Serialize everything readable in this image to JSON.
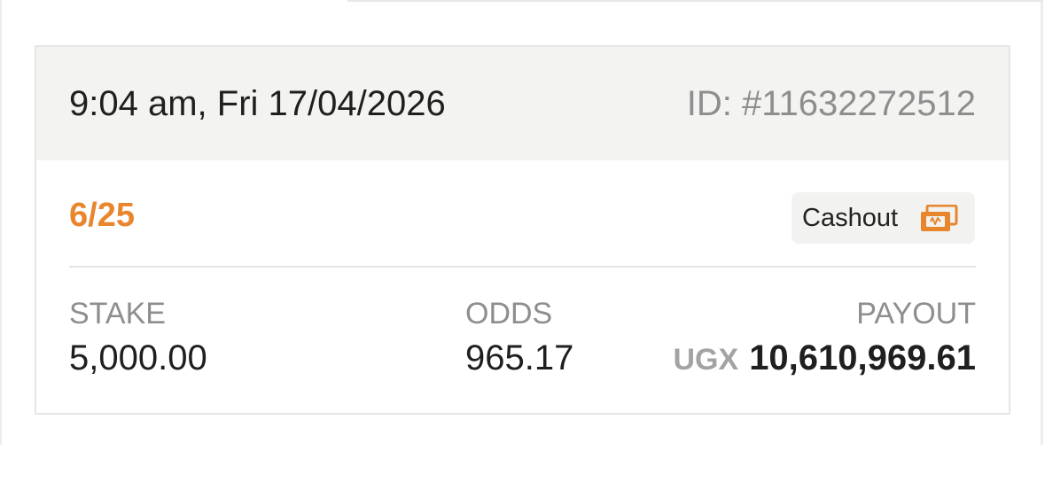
{
  "header": {
    "date_time": "9:04 am, Fri 17/04/2026",
    "bet_id": "ID: #11632272512"
  },
  "summary": {
    "selections": "6/25",
    "cashout_label": "Cashout"
  },
  "stake": {
    "label": "STAKE",
    "value": "5,000.00"
  },
  "odds": {
    "label": "ODDS",
    "value": "965.17"
  },
  "payout": {
    "label": "PAYOUT",
    "currency": "UGX",
    "amount": "10,610,969.61"
  },
  "icons": {
    "cashout": "cashout-money-icon"
  },
  "colors": {
    "accent": "#e8862e",
    "text": "#1f1f1f",
    "muted": "#8e8e8e",
    "header_bg": "#f3f3f1"
  }
}
